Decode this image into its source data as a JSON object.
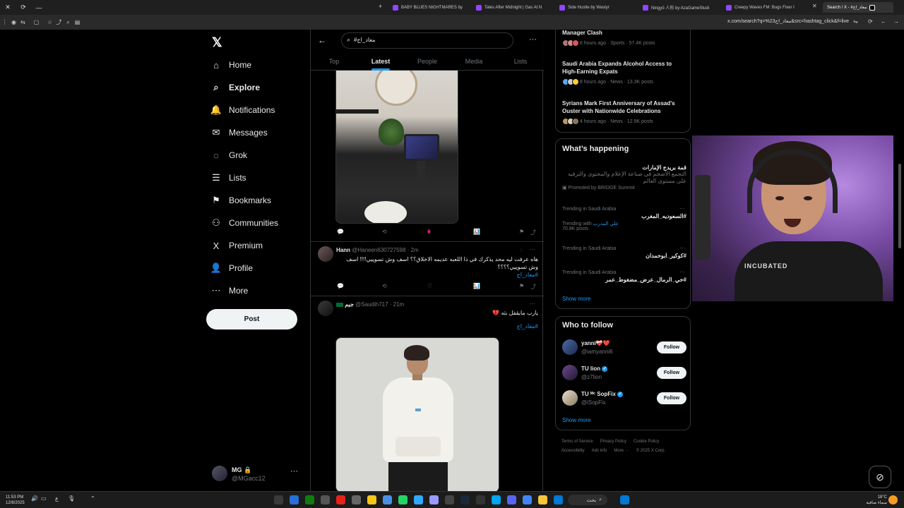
{
  "browser": {
    "tabs": [
      {
        "label": "BABY BLUES NIGHTMARES by",
        "color": "#9146ff"
      },
      {
        "label": "Tales After Midnight | Gas At N",
        "color": "#9146ff"
      },
      {
        "label": "Side Hustle by Wastyr",
        "color": "#9146ff"
      },
      {
        "label": "Ningyō 人形 by AzaGameStudi",
        "color": "#9146ff"
      },
      {
        "label": "Creepy Waves FM: Bugs Fixer I",
        "color": "#9146ff"
      },
      {
        "label": "Search / X - #معاد_اج",
        "color": "#ffffff"
      }
    ],
    "url": "x.com/search?q=%23معاد_اج&src=hashtag_click&f=live"
  },
  "nav": {
    "items": [
      {
        "label": "Home",
        "icon": "home-icon",
        "glyph": "⌂"
      },
      {
        "label": "Explore",
        "icon": "search-icon",
        "glyph": "⌕",
        "bold": true
      },
      {
        "label": "Notifications",
        "icon": "bell-icon",
        "glyph": "🔔"
      },
      {
        "label": "Messages",
        "icon": "mail-icon",
        "glyph": "✉"
      },
      {
        "label": "Grok",
        "icon": "grok-icon",
        "glyph": "◌"
      },
      {
        "label": "Lists",
        "icon": "list-icon",
        "glyph": "☰"
      },
      {
        "label": "Bookmarks",
        "icon": "bookmark-icon",
        "glyph": "⚑"
      },
      {
        "label": "Communities",
        "icon": "communities-icon",
        "glyph": "⚇"
      },
      {
        "label": "Premium",
        "icon": "x-premium-icon",
        "glyph": "X"
      },
      {
        "label": "Profile",
        "icon": "person-icon",
        "glyph": "👤"
      },
      {
        "label": "More",
        "icon": "more-circle-icon",
        "glyph": "⋯"
      }
    ],
    "post_label": "Post",
    "account": {
      "name": "MG",
      "handle": "@MGacc12"
    }
  },
  "search": {
    "query": "#معاد_اج",
    "tabs": [
      "Top",
      "Latest",
      "People",
      "Media",
      "Lists"
    ],
    "active_tab": "Latest"
  },
  "tweets": [
    {
      "likes": "3",
      "views": "33"
    },
    {
      "name": "Hann",
      "handle": "@Haneen630727598",
      "time": "2m",
      "text": "هاه عرفت ليه محد يذكرك في ذا اللعبه عديمه الاخلاق؟؟ اسف وش تسوييي!!!! اسف وش تسوييي؟؟؟؟",
      "hashtag": "#معاد_اج",
      "views": "1"
    },
    {
      "name": "جيم",
      "handle": "@Saudih717",
      "time": "21m",
      "text": "يارب مايقفل بثه 💔",
      "hashtag": "#معاد_اج"
    }
  ],
  "news": [
    {
      "title": "Manager Clash",
      "meta": "6 hours ago · Sports · 57.4K posts"
    },
    {
      "title": "Saudi Arabia Expands Alcohol Access to High-Earning Expats",
      "meta": "8 hours ago · News · 13.3K posts"
    },
    {
      "title": "Syrians Mark First Anniversary of Assad's Ouster with Nationwide Celebrations",
      "meta": "4 hours ago · News · 12.9K posts"
    }
  ],
  "happening": {
    "title": "What’s happening",
    "promo": {
      "title": "قمة بريدج الإمارات",
      "desc": "التجمع الأضخم في صناعة الإعلام والمحتوى والترفيه على مستوى العالم",
      "by": "Promoted by BRIDGE Summit"
    },
    "trends": [
      {
        "category": "Trending in Saudi Arabia",
        "tag": "#السعوديه_المغرب",
        "with_label": "Trending with",
        "with_value": "علي المدرب",
        "posts": "70.8K posts"
      },
      {
        "category": "Trending in Saudi Arabia",
        "tag": "#كوكير_ابوحمدان"
      },
      {
        "category": "Trending in Saudi Arabia",
        "tag": "#حي_الرمال_عرض_مضغوط_عمر"
      }
    ],
    "show_more": "Show more"
  },
  "who_to_follow": {
    "title": "Who to follow",
    "users": [
      {
        "name": "yanni❤️‍🩹❤️",
        "handle": "@iamyanni6",
        "verified": false
      },
      {
        "name": "TU lion",
        "handle": "@z7lion",
        "verified": true
      },
      {
        "name": "TU ᴹᶜ SopFix",
        "handle": "@iSopFix",
        "verified": true
      }
    ],
    "follow_label": "Follow",
    "show_more": "Show more"
  },
  "footer": {
    "links": [
      "Terms of Service",
      "Privacy Policy",
      "Cookie Policy",
      "Accessibility",
      "Ads info",
      "More ···",
      "© 2025 X Corp."
    ]
  },
  "webcam": {
    "caption": "INCUBATED"
  },
  "taskbar": {
    "time": "11:53 PM",
    "date": "12/8/2025",
    "search_label": "بحث",
    "weather_temp": "18°C",
    "weather_desc": "سماء صافية"
  }
}
